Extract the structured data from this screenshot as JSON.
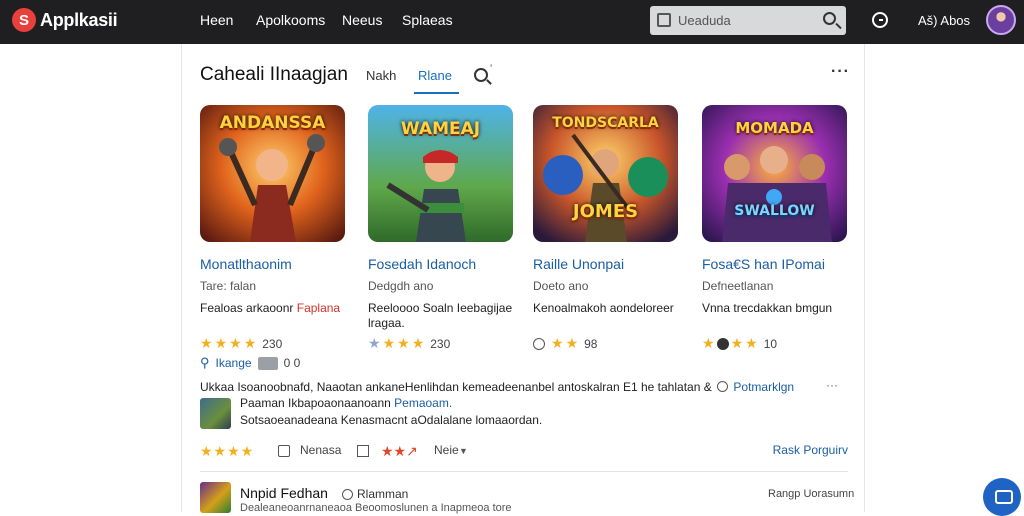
{
  "app": {
    "logo_letter": "S",
    "name": "Applkasii"
  },
  "nav": {
    "items": [
      "Heen",
      "Apolkooms",
      "Neeus",
      "Splaeas"
    ]
  },
  "search": {
    "placeholder": "Ueaduda"
  },
  "user": {
    "name": "Aš) Abos"
  },
  "section": {
    "title": "Caheali IInaagjan",
    "tabs": [
      "Nakh",
      "Rlane"
    ],
    "active_tab": "Rlane"
  },
  "cards": [
    {
      "art_text": "ANDANSSA",
      "title": "Monatlthaonim",
      "subtitle": "Tare: falan",
      "desc": "Fealoas arkaoonr",
      "desc_highlight": "Faplana",
      "rating": "230",
      "meta_link": "Ikange",
      "meta_value": "0 0"
    },
    {
      "art_text": "WAMEAJ",
      "title": "Fosedah Idanoch",
      "subtitle": "Dedgdh ano",
      "desc": "Reeloooo Soaln Ieebagijae lragaa.",
      "desc_highlight": "",
      "rating": "230",
      "meta_link": "",
      "meta_value": ""
    },
    {
      "art_text": "TONDSCARLA",
      "art_text2": "JOMES",
      "title": "Raille Unonpai",
      "subtitle": "Doeto ano",
      "desc": "Kenoalmakoh aondeloreer",
      "desc_highlight": "",
      "rating": "98",
      "meta_link": "",
      "meta_value": ""
    },
    {
      "art_text": "MOMADA",
      "art_text2": "SWALLOW",
      "title": "Fosa€S han IPomai",
      "subtitle": "Defneetlanan",
      "desc": "Vnna trecdakkan bmgun",
      "desc_highlight": "",
      "rating": "10",
      "meta_link": "",
      "meta_value": ""
    }
  ],
  "review": {
    "line": "Ukkaa Isoanoobnafd, Naaotan ankaneHenlihdan kemeadeenanbel antoskalran E1 he tahlatan &",
    "line_link": "Potmarklgn",
    "more": "···",
    "reply_prefix": "Paaman Ikbapoaonaanoann",
    "reply_link": "Pemaoam.",
    "reply_text": "Sotsaoeanadeana Kenasmacnt aOdalalane lomaaordan."
  },
  "actions": {
    "stars": "★★★★",
    "like_label": "Nenasa",
    "stars_red": "★★↗",
    "reply_label": "Neie",
    "read_more": "Rask Porguirv"
  },
  "list_item": {
    "title": "Nnpid Fedhan",
    "tag": "Rlamman",
    "subtitle": "Dealeaneoanrnaneaoa Beoomoslunen a Inapmeoa tore",
    "right": "Rangp Uorasumn"
  }
}
